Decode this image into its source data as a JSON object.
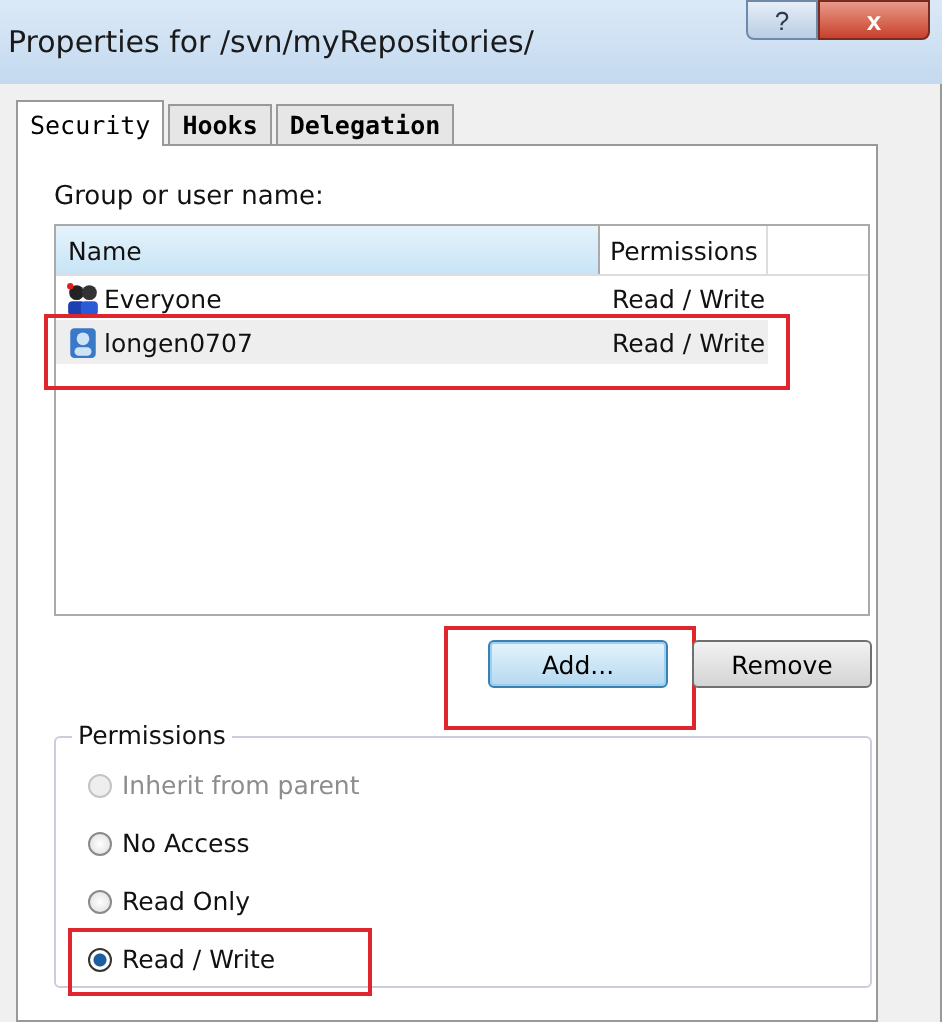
{
  "window": {
    "title": "Properties for /svn/myRepositories/",
    "help_button": "?",
    "close_button": "x"
  },
  "tabs": [
    {
      "label": "Security",
      "selected": true
    },
    {
      "label": "Hooks",
      "selected": false
    },
    {
      "label": "Delegation",
      "selected": false
    }
  ],
  "group_label": "Group or user name:",
  "list": {
    "columns": [
      "Name",
      "Permissions"
    ],
    "rows": [
      {
        "name": "Everyone",
        "permissions": "Read / Write",
        "kind": "group",
        "selected": false,
        "highlighted": false
      },
      {
        "name": "longen0707",
        "permissions": "Read / Write",
        "kind": "user",
        "selected": true,
        "highlighted": true
      }
    ]
  },
  "buttons": [
    {
      "label": "Add...",
      "default": true,
      "highlighted": true
    },
    {
      "label": "Remove",
      "default": false,
      "highlighted": false
    }
  ],
  "permissions": {
    "title": "Permissions",
    "options": [
      {
        "label": "Inherit from parent",
        "disabled": true,
        "selected": false,
        "highlighted": false
      },
      {
        "label": "No Access",
        "disabled": false,
        "selected": false,
        "highlighted": false
      },
      {
        "label": "Read Only",
        "disabled": false,
        "selected": false,
        "highlighted": false
      },
      {
        "label": "Read / Write",
        "disabled": false,
        "selected": true,
        "highlighted": true
      }
    ]
  }
}
